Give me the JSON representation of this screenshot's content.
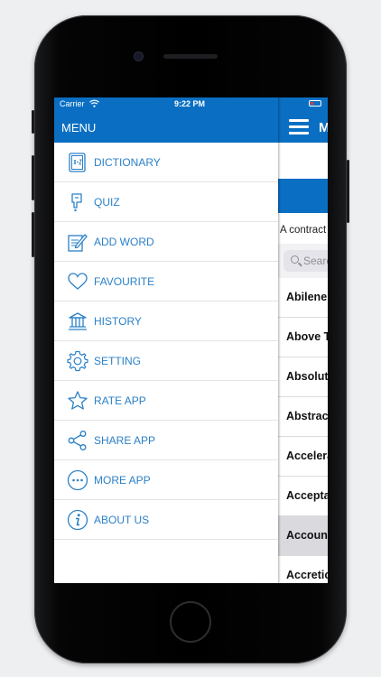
{
  "status_bar": {
    "carrier": "Carrier",
    "time": "9:22 PM"
  },
  "drawer": {
    "title": "MENU",
    "items": [
      {
        "label": "DICTIONARY",
        "icon": "dictionary-icon"
      },
      {
        "label": "QUIZ",
        "icon": "quiz-icon"
      },
      {
        "label": "ADD WORD",
        "icon": "add-word-icon"
      },
      {
        "label": "FAVOURITE",
        "icon": "heart-icon"
      },
      {
        "label": "HISTORY",
        "icon": "history-icon"
      },
      {
        "label": "SETTING",
        "icon": "gear-icon"
      },
      {
        "label": "RATE APP",
        "icon": "star-icon"
      },
      {
        "label": "SHARE APP",
        "icon": "share-icon"
      },
      {
        "label": "MORE APP",
        "icon": "more-icon"
      },
      {
        "label": "ABOUT US",
        "icon": "info-icon"
      }
    ]
  },
  "main": {
    "title_partial": "M",
    "description_partial": "A contract",
    "search_placeholder": "Searc",
    "words": [
      {
        "text": "Abilene",
        "selected": false
      },
      {
        "text": "Above T",
        "selected": false
      },
      {
        "text": "Absolut",
        "selected": false
      },
      {
        "text": "Abstrac",
        "selected": false
      },
      {
        "text": "Accelera",
        "selected": false
      },
      {
        "text": "Accepta",
        "selected": false
      },
      {
        "text": "Account",
        "selected": true
      },
      {
        "text": "Accretic",
        "selected": false
      }
    ]
  },
  "colors": {
    "primary": "#0a6fc2",
    "menu_text": "#2b80c7",
    "selected_row": "#d9d9de"
  }
}
